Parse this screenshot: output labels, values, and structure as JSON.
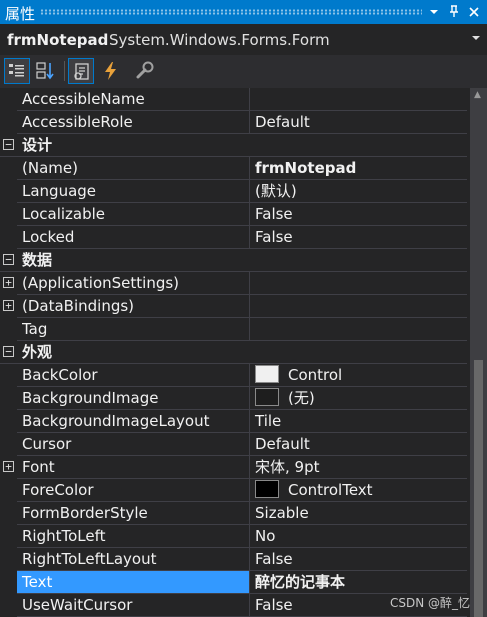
{
  "window": {
    "title": "属性",
    "buttons": [
      {
        "name": "dropdown",
        "glyph": "▼"
      },
      {
        "name": "pin",
        "glyph": "ᵖ"
      },
      {
        "name": "close",
        "glyph": "✕"
      }
    ]
  },
  "object_selector": {
    "name": "frmNotepad",
    "type": "System.Windows.Forms.Form",
    "dropdown_glyph": "▼"
  },
  "toolbar": {
    "buttons": [
      {
        "name": "categorized-button",
        "active": true
      },
      {
        "name": "alphabetical-button",
        "active": false
      },
      {
        "name": "properties-button",
        "active": true
      },
      {
        "name": "events-button",
        "active": false
      },
      {
        "name": "property-pages-button",
        "active": false
      }
    ]
  },
  "grid": {
    "rows": [
      {
        "kind": "prop",
        "name": "AccessibleName",
        "value": ""
      },
      {
        "kind": "prop",
        "name": "AccessibleRole",
        "value": "Default"
      },
      {
        "kind": "cat",
        "name": "设计",
        "toggle": "−"
      },
      {
        "kind": "prop",
        "name": "(Name)",
        "value": "frmNotepad",
        "bold": true
      },
      {
        "kind": "prop",
        "name": "Language",
        "value": "(默认)"
      },
      {
        "kind": "prop",
        "name": "Localizable",
        "value": "False"
      },
      {
        "kind": "prop",
        "name": "Locked",
        "value": "False"
      },
      {
        "kind": "cat",
        "name": "数据",
        "toggle": "−"
      },
      {
        "kind": "prop",
        "name": "(ApplicationSettings)",
        "value": "",
        "toggle": "+"
      },
      {
        "kind": "prop",
        "name": "(DataBindings)",
        "value": "",
        "toggle": "+"
      },
      {
        "kind": "prop",
        "name": "Tag",
        "value": ""
      },
      {
        "kind": "cat",
        "name": "外观",
        "toggle": "−"
      },
      {
        "kind": "prop",
        "name": "BackColor",
        "value": "Control",
        "swatch": "#f0f0f0"
      },
      {
        "kind": "prop",
        "name": "BackgroundImage",
        "value": "(无)",
        "swatch": "#1e1e1e"
      },
      {
        "kind": "prop",
        "name": "BackgroundImageLayout",
        "value": "Tile"
      },
      {
        "kind": "prop",
        "name": "Cursor",
        "value": "Default"
      },
      {
        "kind": "prop",
        "name": "Font",
        "value": "宋体, 9pt",
        "toggle": "+"
      },
      {
        "kind": "prop",
        "name": "ForeColor",
        "value": "ControlText",
        "swatch": "#000000"
      },
      {
        "kind": "prop",
        "name": "FormBorderStyle",
        "value": "Sizable"
      },
      {
        "kind": "prop",
        "name": "RightToLeft",
        "value": "No"
      },
      {
        "kind": "prop",
        "name": "RightToLeftLayout",
        "value": "False"
      },
      {
        "kind": "prop",
        "name": "Text",
        "value": "醉忆的记事本",
        "bold": true,
        "selected": true
      },
      {
        "kind": "prop",
        "name": "UseWaitCursor",
        "value": "False"
      }
    ]
  },
  "watermark": "CSDN @醉_忆",
  "colors": {
    "accent": "#007acc",
    "selection": "#3399ff",
    "background": "#252526"
  }
}
